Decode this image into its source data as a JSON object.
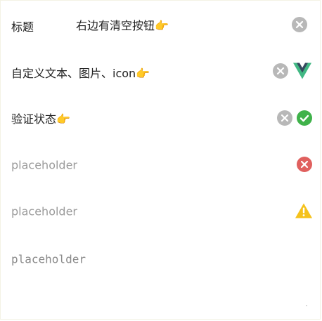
{
  "rows": [
    {
      "label": "标题",
      "value": "右边有清空按钮",
      "emoji": "👉",
      "icons": [
        "clear-icon"
      ]
    },
    {
      "label": "自定义文本、图片、icon",
      "emoji": "👉",
      "icons": [
        "clear-icon",
        "vue-logo-icon"
      ]
    },
    {
      "label": "验证状态",
      "emoji": "👉",
      "icons": [
        "clear-icon",
        "success-icon"
      ]
    },
    {
      "placeholder": "placeholder",
      "icons": [
        "error-icon"
      ]
    },
    {
      "placeholder": "placeholder",
      "icons": [
        "warning-icon"
      ]
    },
    {
      "placeholder": "placeholder",
      "icons": []
    }
  ],
  "colors": {
    "clear": "#b8b8b8",
    "success": "#3fb24a",
    "error": "#e0605e",
    "warning": "#f5c21b",
    "vue_green": "#41b883",
    "vue_dark": "#35495e"
  }
}
